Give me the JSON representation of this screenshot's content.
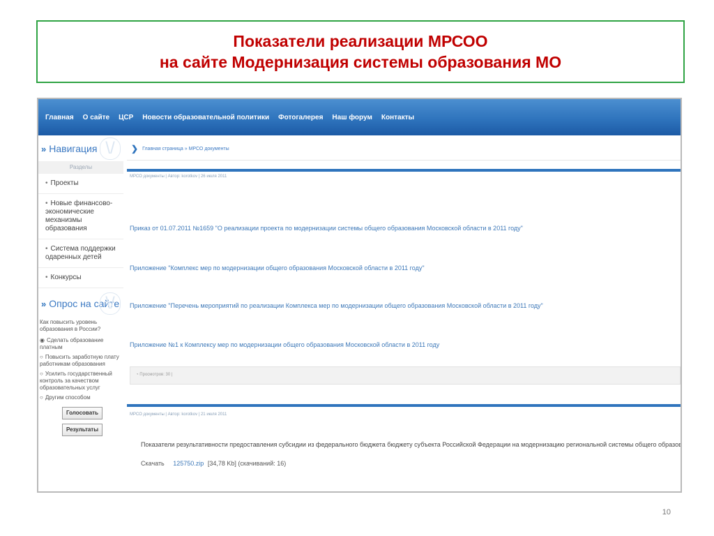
{
  "slide": {
    "title_line1": "Показатели реализации МРСОО",
    "title_line2": "на сайте Модернизация системы образования МО",
    "page_number": "10"
  },
  "topnav": [
    "Главная",
    "О сайте",
    "ЦСР",
    "Новости образовательной политики",
    "Фотогалерея",
    "Наш форум",
    "Контакты"
  ],
  "sidebar": {
    "nav_title": "Навигация",
    "sections_label": "Разделы",
    "items": [
      "Проекты",
      "Новые финансово-экономические механизмы образования",
      "Система поддержки одаренных детей",
      "Конкурсы"
    ],
    "poll_title": "Опрос на сайте",
    "poll_question": "Как повысить уровень образования в России?",
    "poll_options": [
      "Сделать образование платным",
      "Повысить заработную плату работникам образования",
      "Усилить государственный контроль за качеством образовательных услуг",
      "Другим способом"
    ],
    "vote_button": "Голосовать",
    "results_button": "Результаты"
  },
  "main": {
    "breadcrumb": "Главная страница » МРСО документы",
    "meta1": "МРСО документы | Автор: korotkov | 26 июля 2011",
    "docs": [
      "Приказ от 01.07.2011 №1659 \"О реализации проекта по модернизации системы общего образования Московской области в 2011 году\"",
      "Приложение \"Комплекс мер по модернизации общего образования Московской области в 2011 году\"",
      "Приложение \"Перечень мероприятий по реализации Комплекса мер по модернизации общего образования Московской области в 2011 году\"",
      "Приложение №1 к Комплексу мер по модернизации общего образования Московской области в 2011 году"
    ],
    "views": "Просмотров: 30 |",
    "meta2": "МРСО документы | Автор: korotkov | 21 июля 2011",
    "performance_text": "Показатели результативности предоставления субсидии из федерального бюджета бюджету субъекта Российской Федерации на модернизацию региональной системы общего образования",
    "download_label": "Скачать",
    "download_file": "125750.zip",
    "download_info": "[34,78 Kb] (скачиваний: 16)"
  }
}
